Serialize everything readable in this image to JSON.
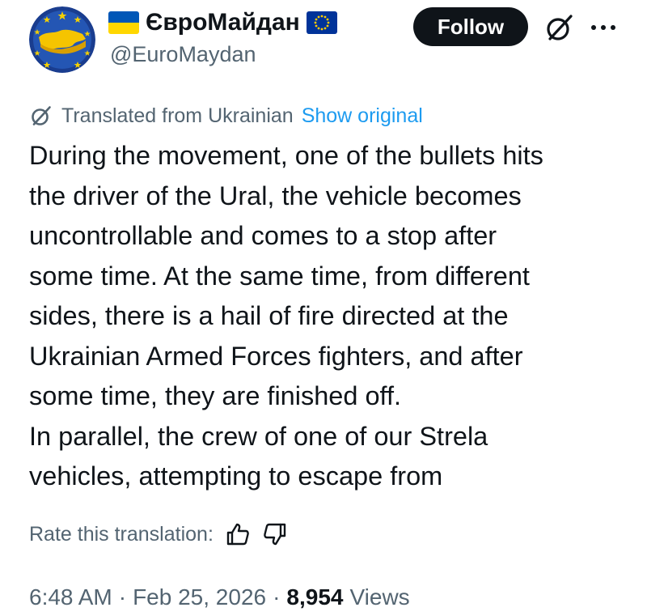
{
  "author": {
    "display_name": "ЄвроМайдан",
    "handle": "@EuroMaydan",
    "avatar_icon": "euromaydan-logo",
    "badge_left_icon": "ukraine-flag-icon",
    "badge_right_icon": "eu-flag-icon"
  },
  "header": {
    "follow_label": "Follow",
    "grok_icon": "grok-icon",
    "more_icon": "more-icon"
  },
  "translation": {
    "translated_label": "Translated from Ukrainian",
    "show_original_label": "Show original",
    "rate_label": "Rate this translation:"
  },
  "tweet": {
    "lines": [
      "During the movement, one of the bullets hits",
      "the driver of the Ural, the vehicle becomes",
      "uncontrollable and comes to a stop after",
      "some time. At the same time, from different",
      "sides, there is a hail of fire directed at the",
      "Ukrainian Armed Forces fighters, and after",
      "some time, they are finished off.",
      "In parallel, the crew of one of our Strela",
      "vehicles, attempting to escape from"
    ]
  },
  "meta": {
    "time": "6:48 AM",
    "separator": "·",
    "date": "Feb 25, 2026",
    "views_count": "8,954",
    "views_label": "Views"
  },
  "colors": {
    "text": "#0f1419",
    "secondary": "#536471",
    "link": "#1d9bf0",
    "ua_blue": "#0057b7",
    "ua_yellow": "#ffd700",
    "eu_blue": "#003399"
  }
}
